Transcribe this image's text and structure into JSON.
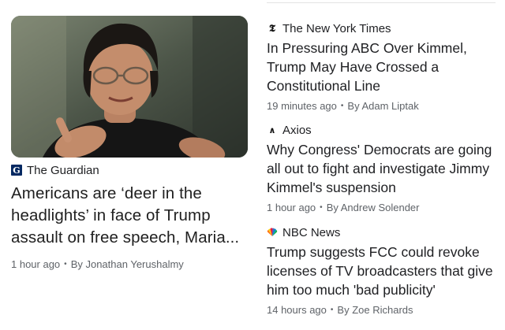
{
  "featured": {
    "image_alt": "",
    "source": "The Guardian",
    "source_icon": "guardian-logo",
    "title": "Americans are ‘deer in the headlights’ in face of Trump assault on free speech, Maria...",
    "time": "1 hour ago",
    "byline": "By Jonathan Yerushalmy"
  },
  "stories": [
    {
      "source": "The New York Times",
      "source_icon": "nyt-logo",
      "title": "In Pressuring ABC Over Kimmel, Trump May Have Crossed a Constitutional Line",
      "time": "19 minutes ago",
      "byline": "By Adam Liptak"
    },
    {
      "source": "Axios",
      "source_icon": "axios-logo",
      "title": "Why Congress' Democrats are going all out to fight and investigate Jimmy Kimmel's suspension",
      "time": "1 hour ago",
      "byline": "By Andrew Solender"
    },
    {
      "source": "NBC News",
      "source_icon": "nbc-peacock-logo",
      "title": "Trump suggests FCC could revoke licenses of TV broadcasters that give him too much 'bad publicity'",
      "time": "14 hours ago",
      "byline": "By Zoe Richards"
    }
  ],
  "colors": {
    "guardian_blue": "#052962",
    "meta_gray": "#5f6368",
    "title_black": "#202124"
  }
}
